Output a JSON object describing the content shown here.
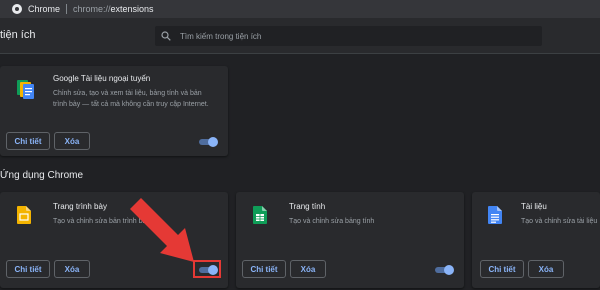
{
  "omnibox": {
    "site": "Chrome",
    "url_scheme": "chrome://",
    "url_path": "extensions"
  },
  "header": {
    "title": "tiện ích",
    "search_placeholder": "Tìm kiếm trong tiện ích"
  },
  "extensions": [
    {
      "name": "Google Tài liệu ngoại tuyến",
      "desc_line1": "Chỉnh sửa, tạo và xem tài liệu, bảng tính và bản",
      "desc_line2": "trình bày — tất cả mà không cần truy cập Internet.",
      "details_label": "Chi tiết",
      "remove_label": "Xóa",
      "enabled": true
    }
  ],
  "apps_section": {
    "title": "Ứng dụng Chrome"
  },
  "apps": [
    {
      "name": "Trang trình bày",
      "desc": "Tạo và chỉnh sửa bản trình bày",
      "details_label": "Chi tiết",
      "remove_label": "Xóa",
      "enabled": true,
      "icon": "slides-icon",
      "color": "#f4b400"
    },
    {
      "name": "Trang tính",
      "desc": "Tạo và chỉnh sửa bảng tính",
      "details_label": "Chi tiết",
      "remove_label": "Xóa",
      "enabled": true,
      "icon": "sheets-icon",
      "color": "#0f9d58"
    },
    {
      "name": "Tài liệu",
      "desc": "Tạo và chỉnh sửa tài liệu",
      "details_label": "Chi tiết",
      "remove_label": "Xóa",
      "enabled": true,
      "icon": "docs-icon",
      "color": "#4285f4"
    }
  ],
  "annotation": {
    "arrow_color": "#e53935",
    "icon": "red-arrow-icon"
  }
}
